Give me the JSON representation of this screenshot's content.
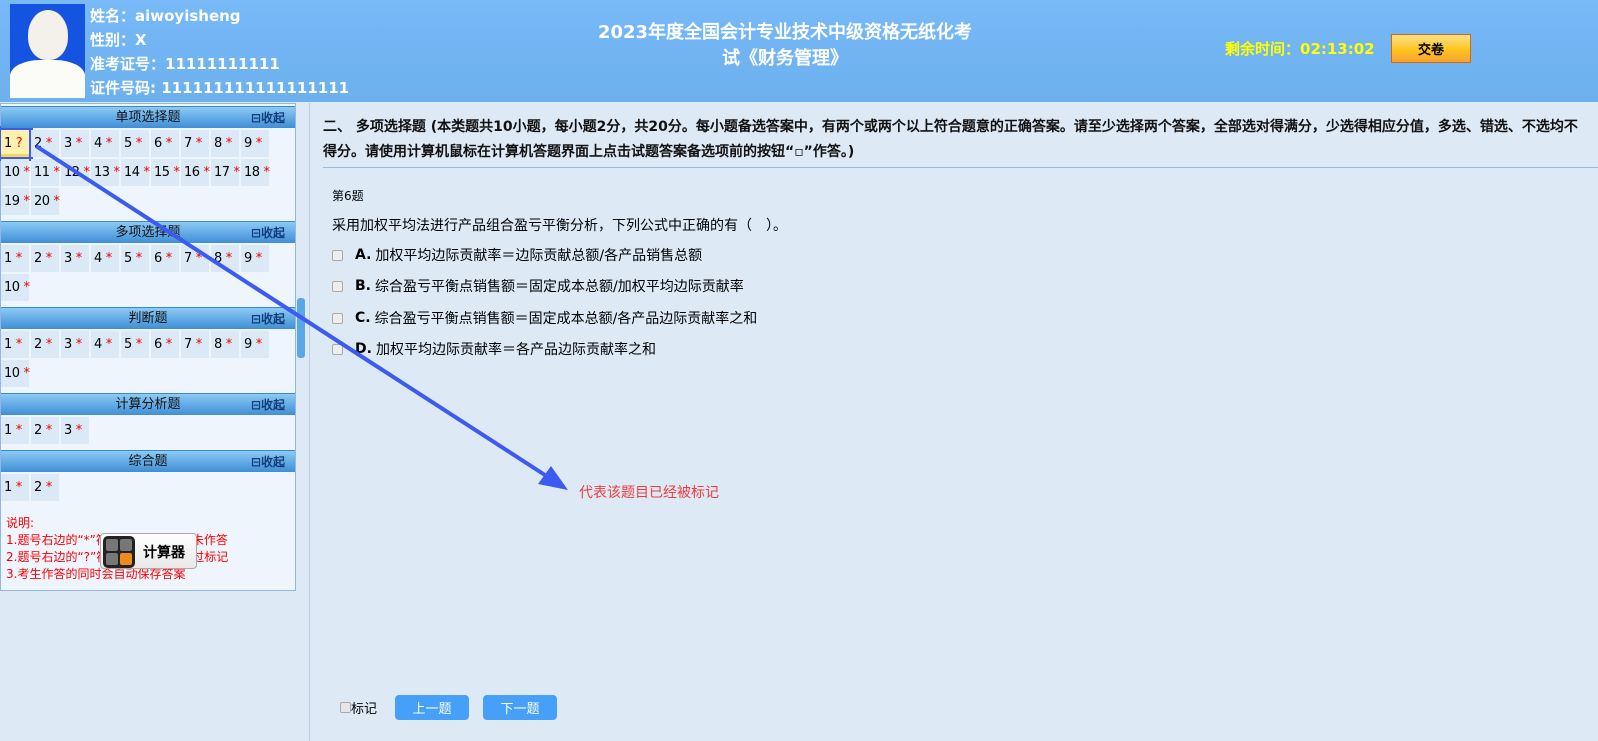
{
  "header": {
    "name": "姓名：aiwoyisheng",
    "gender": "性别：X",
    "exam_no": "准考证号：11111111111",
    "id_no": "证件号码: 111111111111111111",
    "title_line1": "2023年度全国会计专业技术中级资格无纸化考",
    "title_line2": "试《财务管理》",
    "timer": "剩余时间：02:13:02",
    "submit": "交卷"
  },
  "sections": [
    {
      "title": "单项选择题",
      "collapse": "⊟收起",
      "items": [
        {
          "n": "1",
          "s": "?"
        },
        {
          "n": "2",
          "s": "*"
        },
        {
          "n": "3",
          "s": "*"
        },
        {
          "n": "4",
          "s": "*"
        },
        {
          "n": "5",
          "s": "*"
        },
        {
          "n": "6",
          "s": "*"
        },
        {
          "n": "7",
          "s": "*"
        },
        {
          "n": "8",
          "s": "*"
        },
        {
          "n": "9",
          "s": "*"
        },
        {
          "n": "10",
          "s": "*"
        },
        {
          "n": "11",
          "s": "*"
        },
        {
          "n": "12",
          "s": "*"
        },
        {
          "n": "13",
          "s": "*"
        },
        {
          "n": "14",
          "s": "*"
        },
        {
          "n": "15",
          "s": "*"
        },
        {
          "n": "16",
          "s": "*"
        },
        {
          "n": "17",
          "s": "*"
        },
        {
          "n": "18",
          "s": "*"
        },
        {
          "n": "19",
          "s": "*"
        },
        {
          "n": "20",
          "s": "*"
        }
      ]
    },
    {
      "title": "多项选择题",
      "collapse": "⊟收起",
      "items": [
        {
          "n": "1",
          "s": "*"
        },
        {
          "n": "2",
          "s": "*"
        },
        {
          "n": "3",
          "s": "*"
        },
        {
          "n": "4",
          "s": "*"
        },
        {
          "n": "5",
          "s": "*"
        },
        {
          "n": "6",
          "s": "*"
        },
        {
          "n": "7",
          "s": "*"
        },
        {
          "n": "8",
          "s": "*"
        },
        {
          "n": "9",
          "s": "*"
        },
        {
          "n": "10",
          "s": "*"
        }
      ]
    },
    {
      "title": "判断题",
      "collapse": "⊟收起",
      "items": [
        {
          "n": "1",
          "s": "*"
        },
        {
          "n": "2",
          "s": "*"
        },
        {
          "n": "3",
          "s": "*"
        },
        {
          "n": "4",
          "s": "*"
        },
        {
          "n": "5",
          "s": "*"
        },
        {
          "n": "6",
          "s": "*"
        },
        {
          "n": "7",
          "s": "*"
        },
        {
          "n": "8",
          "s": "*"
        },
        {
          "n": "9",
          "s": "*"
        },
        {
          "n": "10",
          "s": "*"
        }
      ]
    },
    {
      "title": "计算分析题",
      "collapse": "⊟收起",
      "items": [
        {
          "n": "1",
          "s": "*"
        },
        {
          "n": "2",
          "s": "*"
        },
        {
          "n": "3",
          "s": "*"
        }
      ]
    },
    {
      "title": "综合题",
      "collapse": "⊟收起",
      "items": [
        {
          "n": "1",
          "s": "*"
        },
        {
          "n": "2",
          "s": "*"
        }
      ]
    }
  ],
  "notes": [
    "说明:",
    "1.题号右边的“*”符号代表该小题尚未作答",
    "2.题号右边的“?”符号代表该小题做过标记",
    "3.考生作答的同时会自动保存答案"
  ],
  "calculator": "计算器",
  "question": {
    "instructions": "二、 多项选择题 (本类题共10小题，每小题2分，共20分。每小题备选答案中，有两个或两个以上符合题意的正确答案。请至少选择两个答案，全部选对得满分，少选得相应分值，多选、错选、不选均不得分。请使用计算机鼠标在计算机答题界面上点击试题答案备选项前的按钮“▫”作答。)",
    "number": "第6题",
    "stem": "采用加权平均法进行产品组合盈亏平衡分析，下列公式中正确的有（　）。",
    "options": [
      {
        "key": "A.",
        "text": "加权平均边际贡献率＝边际贡献总额/各产品销售总额"
      },
      {
        "key": "B.",
        "text": "综合盈亏平衡点销售额＝固定成本总额/加权平均边际贡献率"
      },
      {
        "key": "C.",
        "text": "综合盈亏平衡点销售额＝固定成本总额/各产品边际贡献率之和"
      },
      {
        "key": "D.",
        "text": "加权平均边际贡献率＝各产品边际贡献率之和"
      }
    ]
  },
  "footer": {
    "mark": "标记",
    "prev": "上一题",
    "next": "下一题"
  },
  "annotation": "代表该题目已经被标记",
  "colors": {
    "header": "#75b8f5",
    "arrow": "#3d5af1",
    "timer": "#ffff00",
    "nav_button": "#46a0f8"
  }
}
